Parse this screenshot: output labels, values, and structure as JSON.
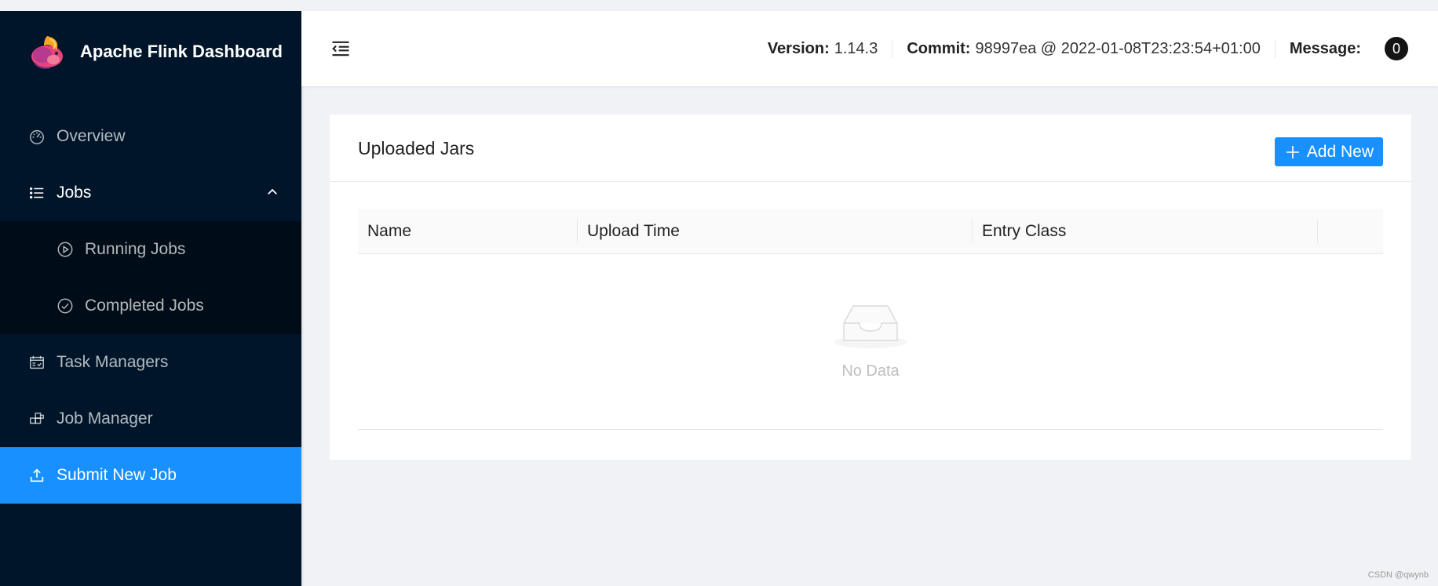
{
  "app": {
    "title": "Apache Flink Dashboard"
  },
  "sidebar": {
    "items": [
      {
        "label": "Overview",
        "icon": "dashboard-icon"
      },
      {
        "label": "Jobs",
        "icon": "unordered-list-icon"
      },
      {
        "label": "Running Jobs",
        "icon": "play-circle-icon"
      },
      {
        "label": "Completed Jobs",
        "icon": "check-circle-icon"
      },
      {
        "label": "Task Managers",
        "icon": "schedule-icon"
      },
      {
        "label": "Job Manager",
        "icon": "build-icon"
      },
      {
        "label": "Submit New Job",
        "icon": "upload-icon"
      }
    ]
  },
  "header": {
    "version_label": "Version:",
    "version_value": "1.14.3",
    "commit_label": "Commit:",
    "commit_value": "98997ea @ 2022-01-08T23:23:54+01:00",
    "message_label": "Message:",
    "message_count": "0"
  },
  "card": {
    "title": "Uploaded Jars",
    "add_button": "Add New",
    "columns": [
      "Name",
      "Upload Time",
      "Entry Class",
      ""
    ],
    "empty_text": "No Data"
  },
  "watermark": "CSDN @qwynb",
  "colors": {
    "sidebar_bg": "#001529",
    "submenu_bg": "#000c17",
    "accent": "#1890ff",
    "page_bg": "#f0f2f5"
  }
}
